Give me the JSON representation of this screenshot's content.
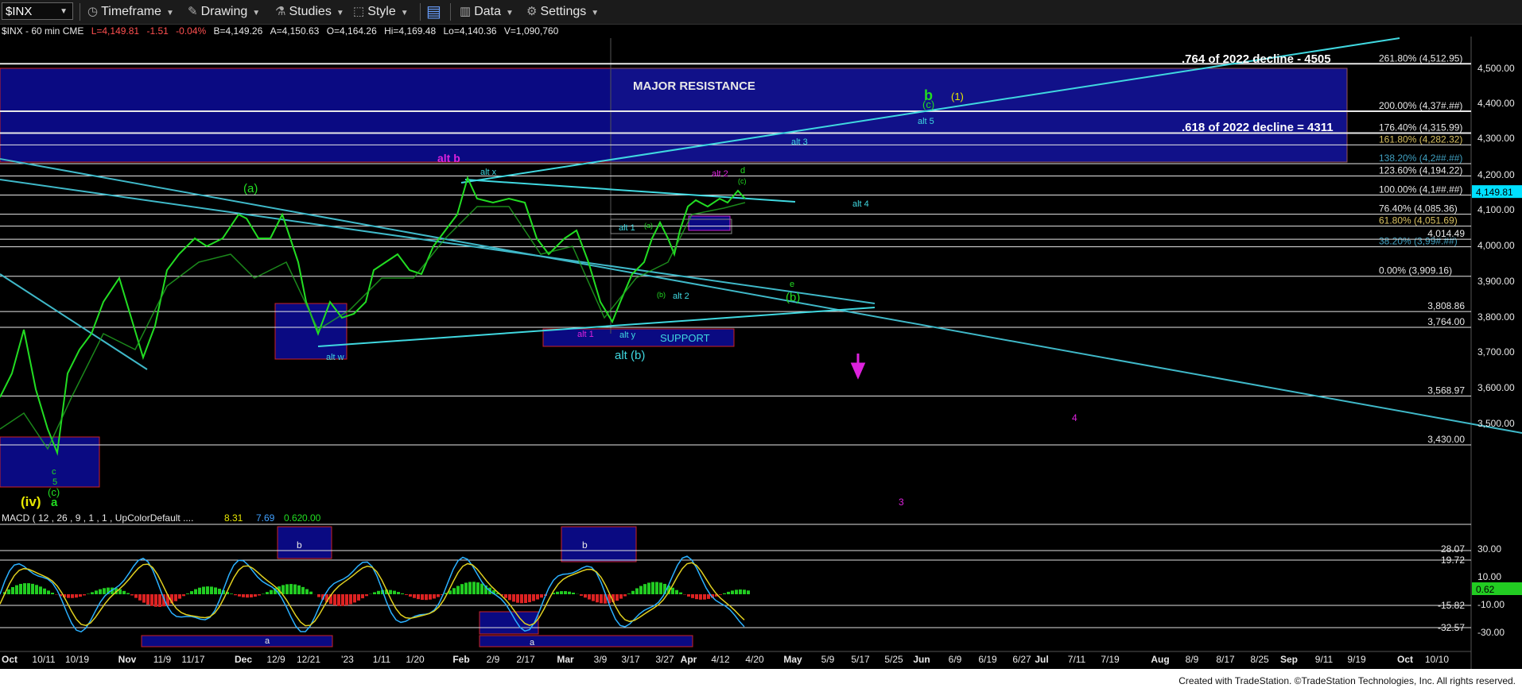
{
  "toolbar": {
    "symbol": "$INX",
    "timeframe": "Timeframe",
    "drawing": "Drawing",
    "studies": "Studies",
    "style": "Style",
    "data": "Data",
    "settings": "Settings"
  },
  "quote": {
    "text": "$INX - 60 min  CME",
    "last": "L=4,149.81",
    "chg": "-1.51",
    "pct": "-0.04%",
    "bid": "B=4,149.26",
    "ask": "A=4,150.63",
    "open": "O=4,164.26",
    "hi": "Hi=4,169.48",
    "lo": "Lo=4,140.36",
    "vol": "V=1,090,760"
  },
  "chart_data": {
    "type": "line",
    "title": "$INX - 60 min",
    "price_axis": {
      "ticks": [
        4500,
        4400,
        4300,
        4200,
        4100,
        4000,
        3900,
        3800,
        3700,
        3600,
        3500
      ],
      "tick_labels": [
        "4,500.00",
        "4,400.00",
        "4,300.00",
        "4,200.00",
        "4,100.00",
        "4,000.00",
        "3,900.00",
        "3,800.00",
        "3,700.00",
        "3,600.00",
        "3,500.00"
      ],
      "last_price_label": "4,149.81",
      "last_price_color": "#00e0ff"
    },
    "time_axis": {
      "labels": [
        "Oct",
        "10/11",
        "10/19",
        "Nov",
        "11/9",
        "11/17",
        "Dec",
        "12/9",
        "12/21",
        "'23",
        "1/11",
        "1/20",
        "Feb",
        "2/9",
        "2/17",
        "Mar",
        "3/9",
        "3/17",
        "3/27",
        "Apr",
        "4/12",
        "4/20",
        "May",
        "5/9",
        "5/17",
        "5/25",
        "Jun",
        "6/9",
        "6/19",
        "6/27",
        "Jul",
        "7/11",
        "7/19",
        "Aug",
        "8/9",
        "8/17",
        "8/25",
        "Sep",
        "9/11",
        "9/19",
        "Oct",
        "10/10"
      ]
    },
    "fib_levels": [
      {
        "label": "261.80% (4,512.95)",
        "price": 4512.95
      },
      {
        "label": "200.00% (4,37#.##)",
        "price": 4378
      },
      {
        "label": "176.40% (4,315.99)",
        "price": 4315.99
      },
      {
        "label": "161.80% (4,282.32)",
        "price": 4282.32
      },
      {
        "label": "138.20% (4,2##.##)",
        "price": 4229
      },
      {
        "label": "123.60% (4,194.22)",
        "price": 4194.22
      },
      {
        "label": "100.00% (4,1##.##)",
        "price": 4140
      },
      {
        "label": "76.40% (4,085.36)",
        "price": 4085.36
      },
      {
        "label": "61.80% (4,051.69)",
        "price": 4051.69
      },
      {
        "label": "38.20% (3,99#.##)",
        "price": 3993
      },
      {
        "label": "0.00% (3,909.16)",
        "price": 3909.16
      }
    ],
    "price_lines": [
      {
        "label": "4,014.49",
        "price": 4014.49
      },
      {
        "label": "3,808.86",
        "price": 3808.86
      },
      {
        "label": "3,764.00",
        "price": 3764.0
      },
      {
        "label": "3,568.97",
        "price": 3568.97
      },
      {
        "label": "3,430.00",
        "price": 3430.0
      }
    ],
    "annotations": {
      "major_resistance": "MAJOR RESISTANCE",
      "decline_764": ".764 of 2022 decline - 4505",
      "decline_618": ".618 of 2022 decline = 4311",
      "support": "SUPPORT",
      "wave_iv": "(iv)",
      "alt_b_top": "alt b",
      "alt_x": "alt x",
      "alt_3": "alt 3",
      "alt_4": "alt 4",
      "alt_5": "alt 5",
      "alt_1a": "alt 1",
      "alt_1b": "alt 1",
      "alt_2a": "alt 2",
      "alt_2b": "alt 2",
      "alt_y": "alt y",
      "alt_w": "alt w",
      "alt_b_paren": "alt (b)",
      "b_green": "b",
      "c_circle": "(c)",
      "one_paren": "(1)",
      "a_paren": "(a)",
      "b_paren": "(b)",
      "small_a": "(a)",
      "small_b": "(b)",
      "small_c": "(c)",
      "d": "d",
      "e": "e",
      "four": "4",
      "three": "3",
      "c5": "c",
      "five": "5",
      "c_paren_low": "(c)",
      "a_low": "a"
    },
    "macd": {
      "label": "MACD ( 12 , 26 , 9 , 1 , 1 , UpColorDefault ....",
      "v1": "8.31",
      "v2": "7.69",
      "v3": "0.62",
      "v4": "0.00",
      "ticks": [
        "30.00",
        "10.00",
        "-10.00",
        "-30.00"
      ],
      "levels": [
        "28.07",
        "19.72",
        "-15.82",
        "-32.57"
      ],
      "last_label": "0.62",
      "box_labels": [
        "b",
        "b",
        "a",
        "a"
      ]
    }
  },
  "footer": "Created with TradeStation. ©TradeStation Technologies, Inc. All rights reserved."
}
